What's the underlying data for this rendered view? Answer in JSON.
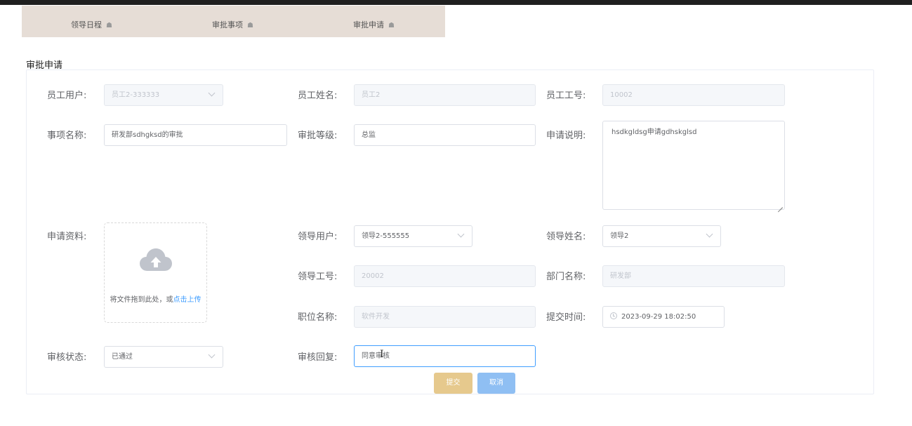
{
  "tabs": [
    {
      "label": "领导日程",
      "icon": "home-icon"
    },
    {
      "label": "审批事项",
      "icon": "home-icon"
    },
    {
      "label": "审批申请",
      "icon": "home-icon"
    }
  ],
  "section_title": "审批申请",
  "form": {
    "employee_user": {
      "label": "员工用户:",
      "value": "员工2-333333"
    },
    "employee_name": {
      "label": "员工姓名:",
      "value": "员工2"
    },
    "employee_no": {
      "label": "员工工号:",
      "value": "10002"
    },
    "item_name": {
      "label": "事项名称:",
      "value": "研发部sdhgksd的审批"
    },
    "approval_level": {
      "label": "审批等级:",
      "value": "总监"
    },
    "application_desc": {
      "label": "申请说明:",
      "value": "hsdkgldsg申请gdhskglsd"
    },
    "materials": {
      "label": "申请资料:",
      "upload_text": "将文件拖到此处，或",
      "upload_link": "点击上传"
    },
    "leader_user": {
      "label": "领导用户:",
      "value": "领导2-555555"
    },
    "leader_name": {
      "label": "领导姓名:",
      "value": "领导2"
    },
    "leader_no": {
      "label": "领导工号:",
      "value": "20002"
    },
    "department": {
      "label": "部门名称:",
      "value": "研发部"
    },
    "position": {
      "label": "职位名称:",
      "value": "软件开发"
    },
    "submit_time": {
      "label": "提交时间:",
      "value": "2023-09-29 18:02:50"
    },
    "review_status": {
      "label": "审核状态:",
      "value": "已通过"
    },
    "review_reply": {
      "label": "审核回复:",
      "value": "同意审核"
    }
  },
  "buttons": {
    "submit": "提交",
    "cancel": "取消"
  },
  "colors": {
    "primary": "#409eff",
    "submit_button": "#e6c98d",
    "cancel_button": "#8fbff3",
    "tab_bar": "#e6ddd6"
  }
}
